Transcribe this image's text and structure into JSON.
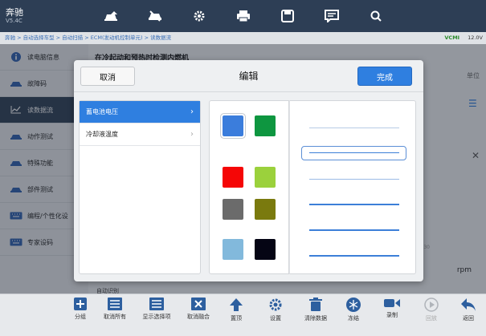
{
  "app": {
    "brand": "奔驰",
    "version": "V5.4C"
  },
  "breadcrumb": {
    "path": "奔驰 > 自动选择车型 > 自动扫描 > ECM(发动机控制单元) > 读数据流",
    "vcmi": "VCMI",
    "power": "12.0V"
  },
  "topbar": {
    "icons": [
      "car-home-icon",
      "wrench-car-icon",
      "gear-icon",
      "printer-icon",
      "help-icon",
      "save-icon",
      "message-icon",
      "search-icon"
    ]
  },
  "sidebar": {
    "items": [
      {
        "label": "读电脑信息",
        "icon": "info-icon",
        "active": false
      },
      {
        "label": "故障码",
        "icon": "car-code-icon",
        "active": false
      },
      {
        "label": "读数据流",
        "icon": "chart-icon",
        "active": true
      },
      {
        "label": "动作测试",
        "icon": "car-action-icon",
        "active": false
      },
      {
        "label": "特殊功能",
        "icon": "car-special-icon",
        "active": false
      },
      {
        "label": "部件测试",
        "icon": "car-parts-icon",
        "active": false
      },
      {
        "label": "编程/个性化设",
        "icon": "keyboard-icon",
        "active": false
      },
      {
        "label": "专家设码",
        "icon": "keyboard-icon",
        "active": false
      }
    ]
  },
  "main": {
    "title": "在冷起动和预热时检测内燃机",
    "unit_header": "单位",
    "unit_value": "rpm",
    "time_tick": "00:30",
    "auto_label": "自动识别"
  },
  "modal": {
    "cancel": "取消",
    "title": "编辑",
    "done": "完成",
    "list": [
      {
        "label": "蓄电池电压",
        "selected": true
      },
      {
        "label": "冷却液温度",
        "selected": false
      }
    ],
    "colors": [
      "#3b7ddc",
      "#0e9640",
      "#f50606",
      "#9bd13c",
      "#6b6b6b",
      "#7a7a0e",
      "#82b9dc",
      "#050514"
    ],
    "selected_color": 0,
    "line_styles": 6,
    "selected_line": 1
  },
  "bottom": {
    "buttons": [
      {
        "label": "分组",
        "icon": "plus-icon",
        "enabled": true
      },
      {
        "label": "取消所有",
        "icon": "list-clear-icon",
        "enabled": true
      },
      {
        "label": "显示选择项",
        "icon": "list-check-icon",
        "enabled": true
      },
      {
        "label": "取消融合",
        "icon": "unmerge-icon",
        "enabled": true
      },
      {
        "label": "置顶",
        "icon": "arrow-up-icon",
        "enabled": true
      },
      {
        "label": "设置",
        "icon": "settings-icon",
        "enabled": true
      },
      {
        "label": "清除数据",
        "icon": "trash-icon",
        "enabled": true
      },
      {
        "label": "冻结",
        "icon": "snowflake-icon",
        "enabled": true
      },
      {
        "label": "录制",
        "icon": "camera-icon",
        "enabled": true
      },
      {
        "label": "回放",
        "icon": "play-icon",
        "enabled": false
      },
      {
        "label": "返回",
        "icon": "back-arrow-icon",
        "enabled": true
      }
    ]
  }
}
